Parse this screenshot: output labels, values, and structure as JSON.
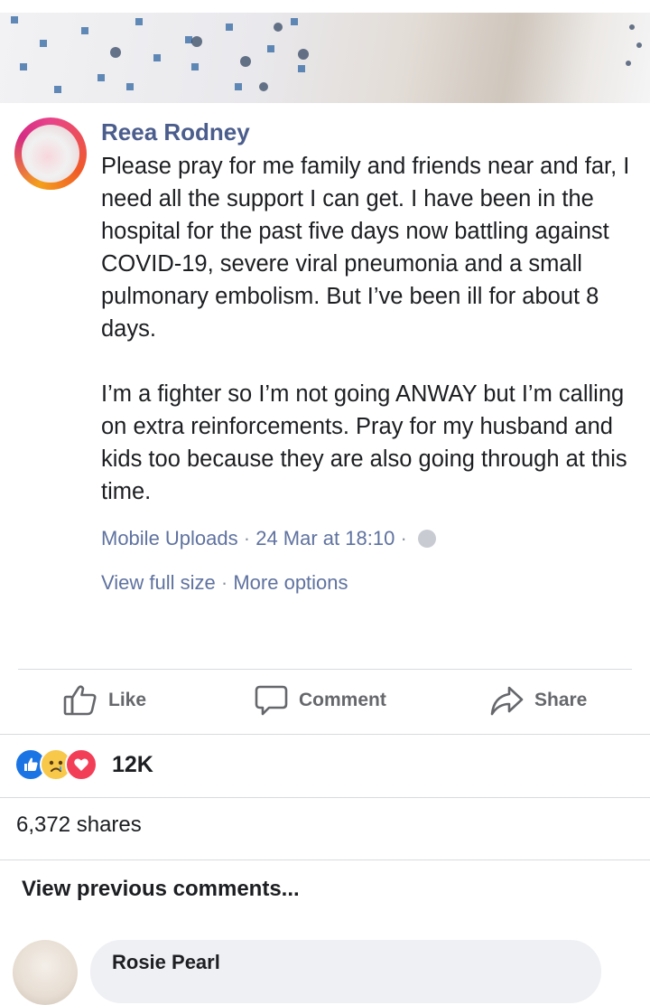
{
  "post": {
    "author": "Reea Rodney",
    "text": "Please pray for me family and friends near and far, I need all the support I can get. I have been in the hospital for the past five days now battling against COVID-19, severe viral pneumonia and a small pulmonary embolism. But I’ve been ill for about 8 days.\n\nI’m a fighter so I’m not going ANWAY but I’m calling on extra reinforcements. Pray for my husband and kids too because they are also going through at this time.",
    "album": "Mobile Uploads",
    "timestamp": "24 Mar at 18:10",
    "separator": "·",
    "privacy_icon": "globe-icon",
    "view_full_size": "View full size",
    "more_options": "More options"
  },
  "actions": {
    "like": "Like",
    "comment": "Comment",
    "share": "Share"
  },
  "reactions": {
    "icons": [
      "like-icon",
      "sad-icon",
      "love-icon"
    ],
    "count": "12K"
  },
  "shares": "6,372 shares",
  "comments": {
    "view_previous": "View previous comments...",
    "first_author": "Rosie Pearl"
  },
  "colors": {
    "link": "#5f72a0",
    "author": "#4b5d8c",
    "like_blue": "#1b74e4",
    "love_red": "#f33e58"
  }
}
